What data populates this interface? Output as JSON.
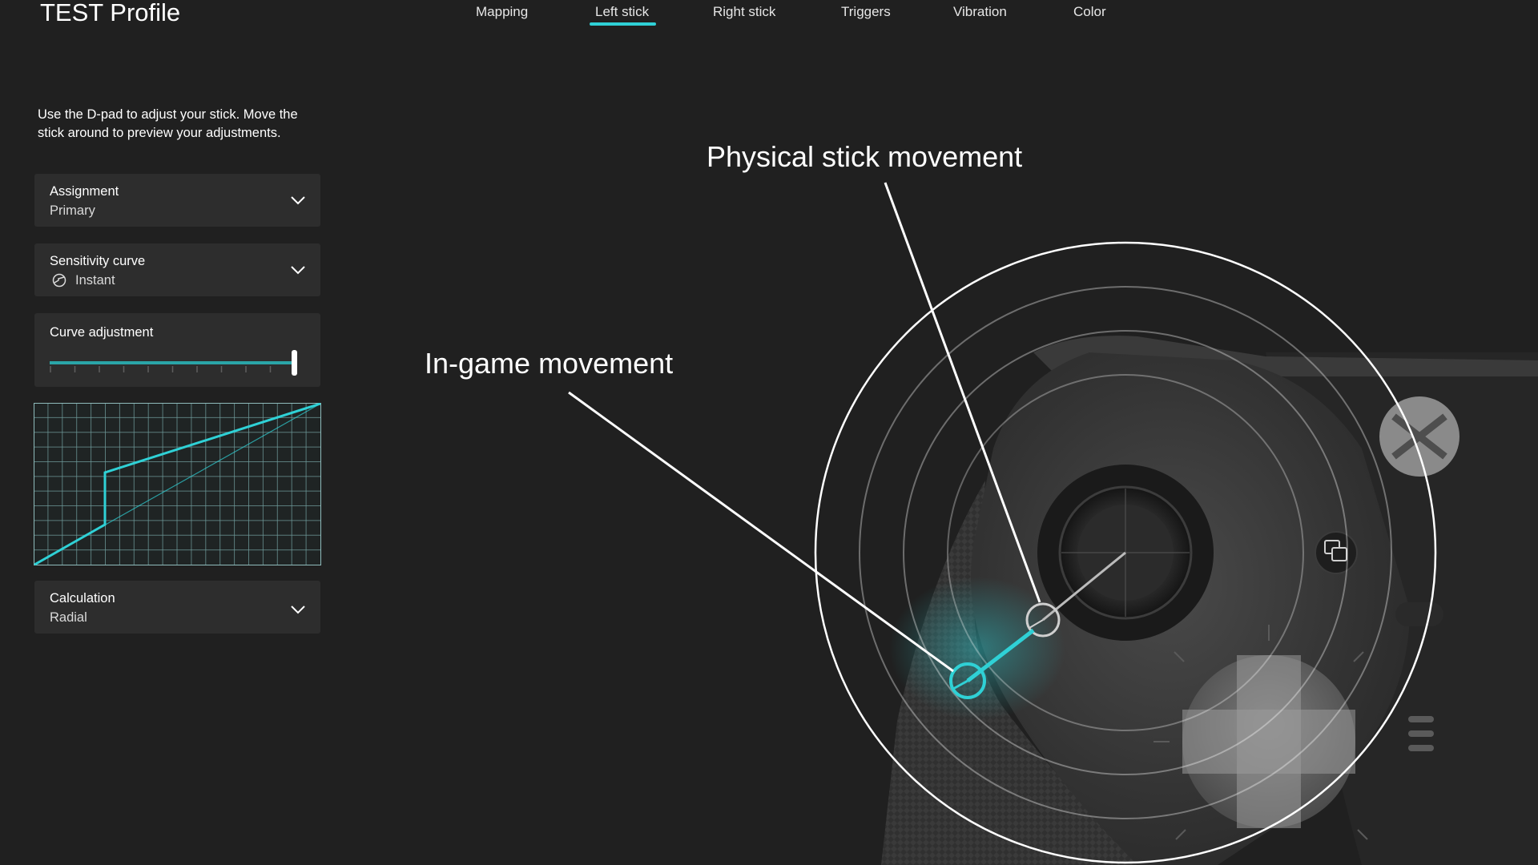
{
  "profile_title": "TEST Profile",
  "tabs": [
    {
      "label": "Mapping",
      "active": false
    },
    {
      "label": "Left stick",
      "active": true
    },
    {
      "label": "Right stick",
      "active": false
    },
    {
      "label": "Triggers",
      "active": false
    },
    {
      "label": "Vibration",
      "active": false
    },
    {
      "label": "Color",
      "active": false
    }
  ],
  "instructions": "Use the D-pad to adjust your stick. Move the stick around to preview your adjustments.",
  "assignment": {
    "label": "Assignment",
    "value": "Primary"
  },
  "sensitivity": {
    "label": "Sensitivity curve",
    "value": "Instant",
    "icon": "instant-curve-icon"
  },
  "curve_adjustment": {
    "label": "Curve adjustment",
    "slider_value": 1.0
  },
  "calculation": {
    "label": "Calculation",
    "value": "Radial"
  },
  "callouts": {
    "physical": "Physical stick movement",
    "ingame": "In-game movement"
  },
  "colors": {
    "accent": "#2fd1d6",
    "background": "#202020",
    "panel": "#2d2d2d",
    "grid": "#7fb0b0"
  }
}
